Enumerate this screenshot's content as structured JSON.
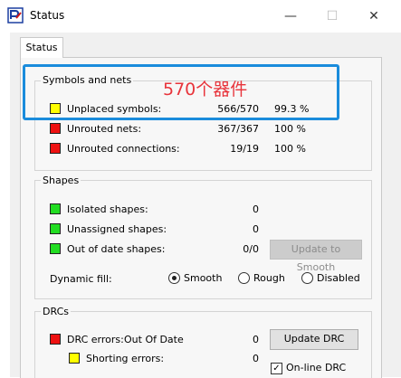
{
  "window": {
    "title": "Status",
    "min_glyph": "—",
    "max_glyph": "☐",
    "close_glyph": "✕"
  },
  "tabs": [
    {
      "label": "Status"
    }
  ],
  "symbols_nets": {
    "label": "Symbols and nets",
    "rows": [
      {
        "label": "Unplaced symbols:",
        "count": "566/570",
        "percent": "99.3 %",
        "color": "#ffff00"
      },
      {
        "label": "Unrouted nets:",
        "count": "367/367",
        "percent": "100 %",
        "color": "#ee1111"
      },
      {
        "label": "Unrouted connections:",
        "count": "19/19",
        "percent": "100 %",
        "color": "#ee1111"
      }
    ]
  },
  "shapes": {
    "label": "Shapes",
    "rows": [
      {
        "label": "Isolated shapes:",
        "count": "0",
        "color": "#22dd22"
      },
      {
        "label": "Unassigned shapes:",
        "count": "0",
        "color": "#22dd22"
      },
      {
        "label": "Out of date shapes:",
        "count": "0/0",
        "color": "#22dd22"
      }
    ],
    "update_button": "Update to Smooth",
    "dynamic_fill": {
      "label": "Dynamic fill:",
      "options": [
        "Smooth",
        "Rough",
        "Disabled"
      ],
      "selected": "Smooth"
    }
  },
  "drcs": {
    "label": "DRCs",
    "drc_errors_label": "DRC errors:",
    "drc_status": "Out Of Date",
    "drc_errors_count": "0",
    "shorting_label": "Shorting errors:",
    "shorting_count": "0",
    "update_button": "Update DRC",
    "online_label": "On-line DRC",
    "online_checked": true
  },
  "annotation": {
    "text": "570个器件",
    "color": "#e8343b",
    "box_color": "#1a8cdc"
  }
}
